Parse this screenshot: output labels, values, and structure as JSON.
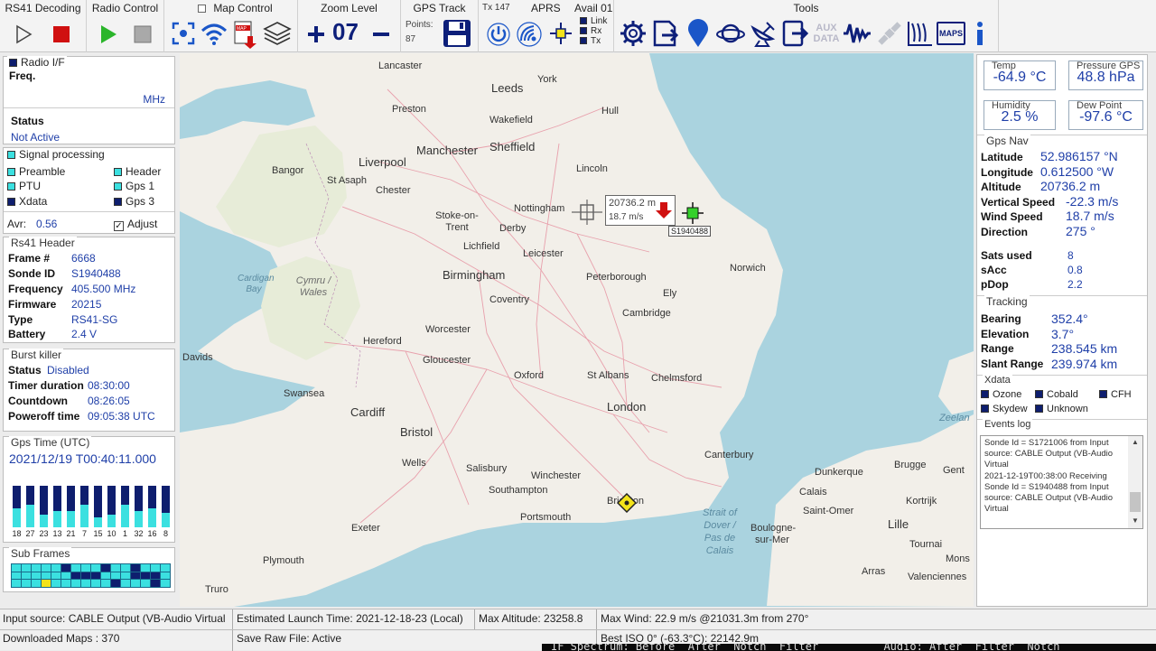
{
  "toolbar": {
    "rs41_decoding": "RS41 Decoding",
    "radio_control": "Radio Control",
    "map_control": "Map Control",
    "zoom_level": "Zoom Level",
    "zoom_value": "07",
    "gps_track": "GPS Track",
    "points_label": "Points:",
    "points_value": "87",
    "tx_label": "Tx 147",
    "aprs": "APRS",
    "avail": "Avail 01",
    "link": "Link",
    "rx": "Rx",
    "tx": "Tx",
    "tools": "Tools",
    "aux": "AUX",
    "data": "DATA",
    "maps": "MAPS"
  },
  "radio_if": {
    "title": "Radio I/F",
    "freq_label": "Freq.",
    "unit": "MHz",
    "status_label": "Status",
    "status_value": "Not Active"
  },
  "signal": {
    "title": "Signal processing",
    "items": [
      "Preamble",
      "Header",
      "PTU",
      "Gps 1",
      "Xdata",
      "Gps 3"
    ],
    "avr_label": "Avr:",
    "avr_value": "0.56",
    "adjust_label": "Adjust"
  },
  "rs41_header": {
    "title": "Rs41 Header",
    "rows": [
      {
        "label": "Frame #",
        "value": "6668"
      },
      {
        "label": "Sonde ID",
        "value": "S1940488"
      },
      {
        "label": "Frequency",
        "value": "405.500 MHz"
      },
      {
        "label": "Firmware",
        "value": "20215"
      },
      {
        "label": "Type",
        "value": "RS41-SG"
      },
      {
        "label": "Battery",
        "value": "2.4 V"
      }
    ]
  },
  "burst": {
    "title": "Burst killer",
    "status_label": "Status",
    "status_value": "Disabled",
    "rows": [
      {
        "label": "Timer duration",
        "value": "08:30:00"
      },
      {
        "label": "Countdown",
        "value": "08:26:05"
      },
      {
        "label": "Poweroff time",
        "value": "09:05:38 UTC"
      }
    ]
  },
  "gps_time": {
    "title": "Gps Time (UTC)",
    "value": "2021/12/19 T00:40:11.000",
    "bar_labels": [
      "18",
      "27",
      "23",
      "13",
      "21",
      "7",
      "15",
      "10",
      "1",
      "32",
      "16",
      "8"
    ],
    "bar_levels": [
      0.45,
      0.55,
      0.3,
      0.4,
      0.4,
      0.55,
      0.25,
      0.3,
      0.55,
      0.4,
      0.45,
      0.35
    ]
  },
  "subframes": {
    "title": "Sub Frames"
  },
  "map": {
    "cities": [
      "Lancaster",
      "Leeds",
      "York",
      "Preston",
      "Wakefield",
      "Hull",
      "Manchester",
      "Sheffield",
      "Liverpool",
      "Bangor",
      "St Asaph",
      "Chester",
      "Lincoln",
      "Nottingham",
      "Stoke-on-Trent",
      "Derby",
      "Lichfield",
      "Leicester",
      "Birmingham",
      "Peterborough",
      "Norwich",
      "Coventry",
      "Ely",
      "Cymru / Wales",
      "Cardigan Bay",
      "Worcester",
      "Cambridge",
      "Hereford",
      "Davids",
      "Gloucester",
      "Oxford",
      "St Albans",
      "Chelmsford",
      "Swansea",
      "London",
      "Cardiff",
      "Bristol",
      "Canterbury",
      "Wells",
      "Salisbury",
      "Winchester",
      "Southampton",
      "Portsmouth",
      "Brighton",
      "Exeter",
      "Plymouth",
      "Truro",
      "Strait of Dover / Pas de Calais",
      "Dunkerque",
      "Calais",
      "Brugge",
      "Gent",
      "Kortrijk",
      "Saint-Omer",
      "Lille",
      "Boulogne-sur-Mer",
      "Tournai",
      "Mons",
      "Arras",
      "Valenciennes",
      "Zeelan"
    ],
    "tooltip_alt": "20736.2 m",
    "tooltip_speed": "18.7 m/s",
    "sonde_label": "S1940488"
  },
  "readouts": {
    "temp_label": "Temp",
    "temp_value": "-64.9 °C",
    "pressure_label": "Pressure GPS",
    "pressure_value": "48.8 hPa",
    "humidity_label": "Humidity",
    "humidity_value": "2.5 %",
    "dew_label": "Dew Point",
    "dew_value": "-97.6 °C"
  },
  "gps_nav": {
    "title": "Gps Nav",
    "rows": [
      {
        "label": "Latitude",
        "value": "52.986157 °N"
      },
      {
        "label": "Longitude",
        "value": "0.612500 °W"
      },
      {
        "label": "Altitude",
        "value": "20736.2 m"
      },
      {
        "label": "Vertical Speed",
        "value": "-22.3 m/s"
      },
      {
        "label": "Wind Speed",
        "value": "18.7 m/s"
      },
      {
        "label": "Direction",
        "value": "275 °"
      }
    ],
    "rows2": [
      {
        "label": "Sats used",
        "value": "8"
      },
      {
        "label": "sAcc",
        "value": "0.8"
      },
      {
        "label": "pDop",
        "value": "2.2"
      }
    ]
  },
  "tracking": {
    "title": "Tracking",
    "rows": [
      {
        "label": "Bearing",
        "value": "352.4°"
      },
      {
        "label": "Elevation",
        "value": "3.7°"
      },
      {
        "label": "Range",
        "value": "238.545 km"
      },
      {
        "label": "Slant Range",
        "value": "239.974 km"
      }
    ]
  },
  "xdata": {
    "title": "Xdata",
    "items": [
      "Ozone",
      "Cobald",
      "CFH",
      "Skydew",
      "Unknown"
    ]
  },
  "events": {
    "title": "Events log",
    "lines": [
      "Sonde Id = S1721006 from Input",
      "source: CABLE Output (VB-Audio",
      "Virtual",
      "2021-12-19T00:38:00 Receiving",
      "Sonde Id = S1940488 from Input",
      "source: CABLE Output (VB-Audio",
      "Virtual"
    ]
  },
  "status": {
    "input_source": "Input source: CABLE Output (VB-Audio Virtual",
    "launch": "Estimated Launch Time: 2021-12-18-23 (Local)",
    "max_alt": "Max Altitude: 23258.8",
    "max_wind": "Max Wind: 22.9 m/s @21031.3m from 270°",
    "downloaded": "Downloaded Maps : 370",
    "raw": "Save Raw File: Active",
    "best_iso": "Best ISO 0° (-63.3°C): 22142.9m",
    "bg_text": "IF Spectrum: Before  After  Notch  Filter          Audio: After  Filter  Notch"
  },
  "colors": {
    "accent": "#1f3fa8",
    "dark_box": "#0e1e6e",
    "cyan_box": "#3be0e0",
    "map_water": "#aad3df",
    "map_land": "#f2efe9"
  }
}
